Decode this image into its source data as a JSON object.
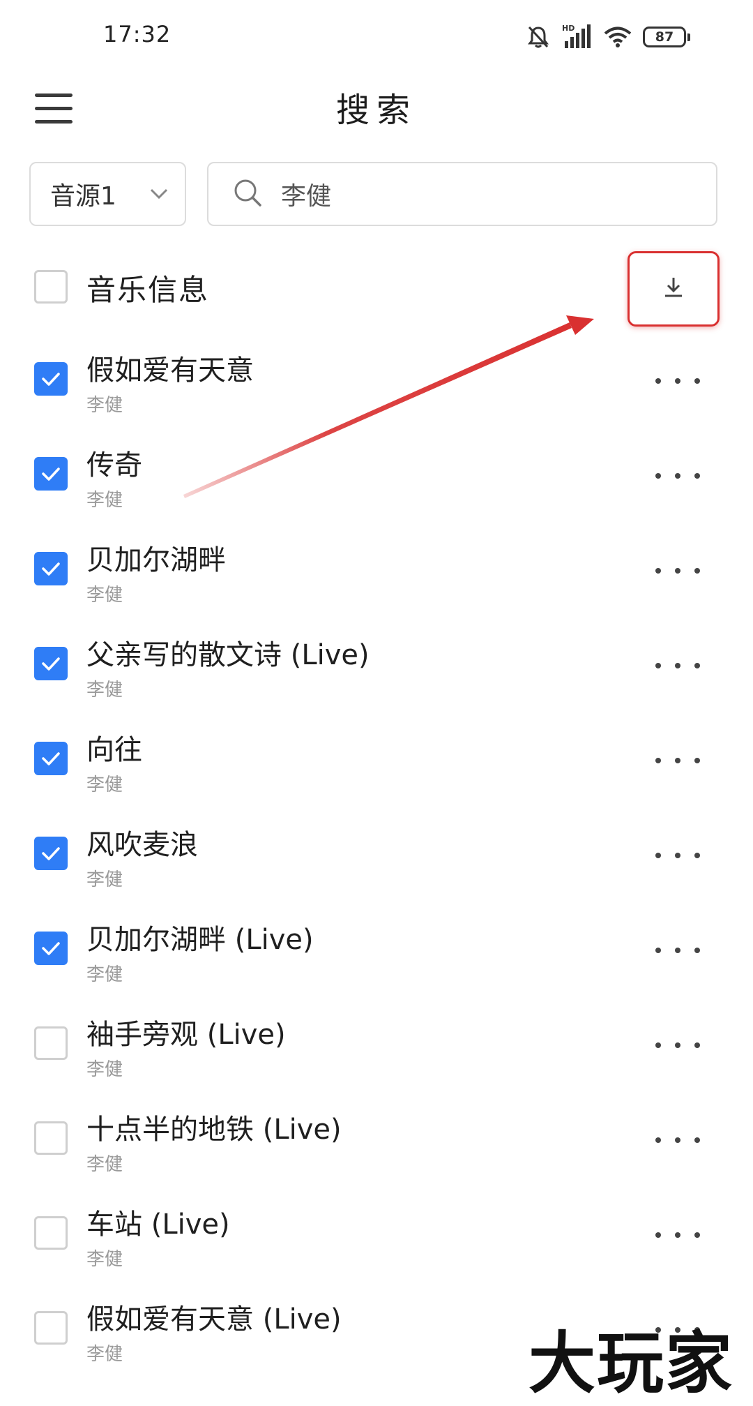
{
  "status_bar": {
    "time": "17:32",
    "battery": "87",
    "icons": [
      "bell-off-icon",
      "hd-signal-icon",
      "wifi-icon",
      "battery-icon"
    ]
  },
  "header": {
    "title": "搜索",
    "menu_icon": "hamburger-menu-icon"
  },
  "search": {
    "source_label": "音源1",
    "query": "李健"
  },
  "list_header": {
    "label": "音乐信息",
    "checked": false,
    "download_icon": "download-icon"
  },
  "songs": [
    {
      "title": "假如爱有天意",
      "artist": "李健",
      "checked": true
    },
    {
      "title": "传奇",
      "artist": "李健",
      "checked": true
    },
    {
      "title": "贝加尔湖畔",
      "artist": "李健",
      "checked": true
    },
    {
      "title": "父亲写的散文诗 (Live)",
      "artist": "李健",
      "checked": true
    },
    {
      "title": "向往",
      "artist": "李健",
      "checked": true
    },
    {
      "title": "风吹麦浪",
      "artist": "李健",
      "checked": true
    },
    {
      "title": "贝加尔湖畔 (Live)",
      "artist": "李健",
      "checked": true
    },
    {
      "title": "袖手旁观 (Live)",
      "artist": "李健",
      "checked": false
    },
    {
      "title": "十点半的地铁 (Live)",
      "artist": "李健",
      "checked": false
    },
    {
      "title": "车站 (Live)",
      "artist": "李健",
      "checked": false
    },
    {
      "title": "假如爱有天意 (Live)",
      "artist": "李健",
      "checked": false
    }
  ],
  "watermark": {
    "text": "大玩家"
  },
  "colors": {
    "accent": "#2f7df6",
    "annotation_red": "#d93030"
  }
}
